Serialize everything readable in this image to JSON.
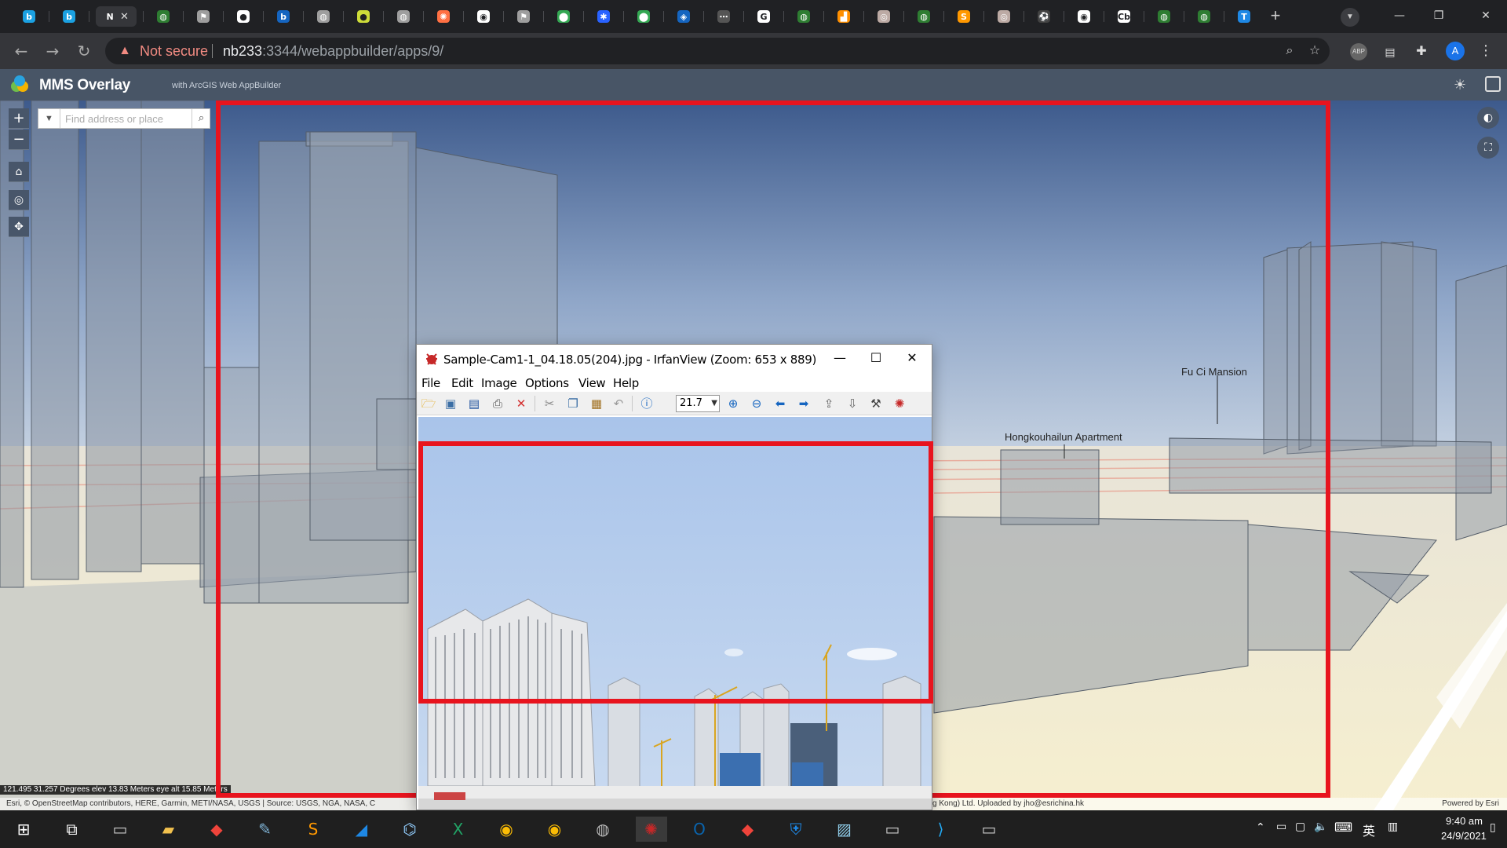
{
  "browser": {
    "tabs": [
      {
        "icon": "bing-icon",
        "color": "#1ba1e2",
        "glyph": "b"
      },
      {
        "icon": "bing-icon",
        "color": "#1ba1e2",
        "glyph": "b"
      },
      {
        "icon": "active-tab",
        "color": "#35363a",
        "glyph": "N",
        "active": true,
        "close": "✕"
      },
      {
        "icon": "globe-icon",
        "color": "#2e7d32",
        "glyph": "◍"
      },
      {
        "icon": "flag-icon",
        "color": "#9e9e9e",
        "glyph": "⚑"
      },
      {
        "icon": "github-icon",
        "color": "#ffffff",
        "glyph": "●"
      },
      {
        "icon": "bing-icon",
        "color": "#1565c0",
        "glyph": "b"
      },
      {
        "icon": "globe-icon",
        "color": "#9e9e9e",
        "glyph": "◍"
      },
      {
        "icon": "tennis-icon",
        "color": "#cddc39",
        "glyph": "●"
      },
      {
        "icon": "globe-icon",
        "color": "#9e9e9e",
        "glyph": "◍"
      },
      {
        "icon": "blur-icon",
        "color": "#ff7043",
        "glyph": "✺"
      },
      {
        "icon": "chrome-icon",
        "color": "#ffffff",
        "glyph": "◉"
      },
      {
        "icon": "flag-icon",
        "color": "#9e9e9e",
        "glyph": "⚑"
      },
      {
        "icon": "maps-pin-icon",
        "color": "#34a853",
        "glyph": "⬤"
      },
      {
        "icon": "baidu-icon",
        "color": "#2962ff",
        "glyph": "✱"
      },
      {
        "icon": "maps-pin-icon",
        "color": "#34a853",
        "glyph": "⬤"
      },
      {
        "icon": "app-icon",
        "color": "#1565c0",
        "glyph": "◈"
      },
      {
        "icon": "dots-icon",
        "color": "#555555",
        "glyph": "⋯"
      },
      {
        "icon": "google-icon",
        "color": "#ffffff",
        "glyph": "G"
      },
      {
        "icon": "globe-icon",
        "color": "#2e7d32",
        "glyph": "◍"
      },
      {
        "icon": "chart-icon",
        "color": "#ff8f00",
        "glyph": "▟"
      },
      {
        "icon": "coin-icon",
        "color": "#bcaaa4",
        "glyph": "◎"
      },
      {
        "icon": "globe-icon",
        "color": "#2e7d32",
        "glyph": "◍"
      },
      {
        "icon": "sublime-icon",
        "color": "#ff9800",
        "glyph": "S"
      },
      {
        "icon": "coin-icon",
        "color": "#bcaaa4",
        "glyph": "◎"
      },
      {
        "icon": "football-icon",
        "color": "#424242",
        "glyph": "⚽"
      },
      {
        "icon": "chrome-icon",
        "color": "#ffffff",
        "glyph": "◉"
      },
      {
        "icon": "cb-icon",
        "color": "#ffffff",
        "glyph": "Cb"
      },
      {
        "icon": "globe-icon",
        "color": "#2e7d32",
        "glyph": "◍"
      },
      {
        "icon": "globe-icon",
        "color": "#2e7d32",
        "glyph": "◍"
      },
      {
        "icon": "t-icon",
        "color": "#1e88e5",
        "glyph": "T"
      }
    ],
    "new_tab": "+",
    "security_label": "Not secure",
    "url_host": "nb233",
    "url_rest": ":3344/webappbuilder/apps/9/",
    "profile_initial": "A"
  },
  "app": {
    "title": "MMS Overlay",
    "subtitle": "with ArcGIS Web AppBuilder"
  },
  "map": {
    "search_placeholder": "Find address or place",
    "labels": {
      "fu_ci": "Fu Ci Mansion",
      "hongkouhailun": "Hongkouhailun Apartment"
    },
    "coord_readout": "121.495 31.257 Degrees   elev 13.83 Meters   eye alt 15.85 Meters",
    "attribution": "Esri, © OpenStreetMap contributors, HERE, Garmin, METI/NASA, USGS | Source: USGS, NGA, NASA, C",
    "attribution_right": "g Kong) Ltd. Uploaded by jho@esrichina.hk",
    "powered_by": "Powered by Esri"
  },
  "irfanview": {
    "title": "Sample-Cam1-1_04.18.05(204).jpg - IrfanView (Zoom: 653 x 889)",
    "menu": [
      "File",
      "Edit",
      "Image",
      "Options",
      "View",
      "Help"
    ],
    "zoom_value": "21.7"
  },
  "taskbar": {
    "time": "9:40 am",
    "date": "24/9/2021",
    "ime": "英",
    "apps": [
      "windows-start-icon",
      "task-view-icon",
      "terminal-icon",
      "file-explorer-icon",
      "anydesk-icon",
      "paint-icon",
      "sublime-icon",
      "shark-icon",
      "network-icon",
      "excel-icon",
      "chrome-icon",
      "chrome-icon",
      "steam-icon",
      "irfanview-icon",
      "outlook-icon",
      "anydesk-icon",
      "vpn-icon",
      "notepad-icon",
      "terminal-icon",
      "vscode-icon",
      "terminal-icon"
    ]
  },
  "colors": {
    "annotation_red": "#e8141e",
    "header_bg": "#485566",
    "taskbar_bg": "#1f1f1f",
    "sky_top": "#3d5a8c",
    "sky_bottom": "#b5c4d8"
  }
}
